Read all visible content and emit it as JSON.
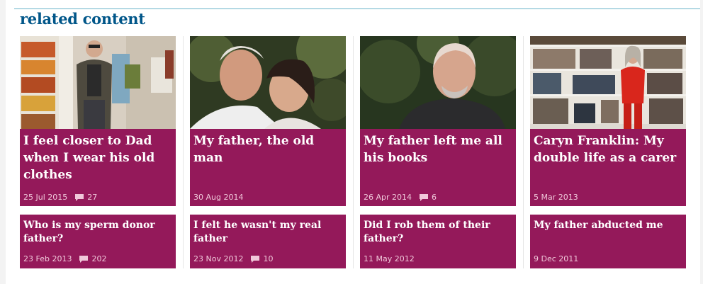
{
  "heading": "related content",
  "colors": {
    "accent": "#005689",
    "card_bg": "#94195a",
    "meta_text": "#f0c8da",
    "rule": "#69b4c9"
  },
  "feature_cards": [
    {
      "title": "I feel closer to Dad when I wear his old clothes",
      "date": "25 Jul 2015",
      "comments": "27",
      "image": "man-in-hallway-photo"
    },
    {
      "title": "My father, the old man",
      "date": "30 Aug 2014",
      "comments": null,
      "image": "father-and-daughter-photo"
    },
    {
      "title": "My father left me all his books",
      "date": "26 Apr 2014",
      "comments": "6",
      "image": "bald-man-portrait-photo"
    },
    {
      "title": "Caryn Franklin: My double life as a carer",
      "date": "5 Mar 2013",
      "comments": null,
      "image": "woman-by-bookshelf-photo"
    }
  ],
  "small_cards": [
    {
      "title": "Who is my sperm donor father?",
      "date": "23 Feb 2013",
      "comments": "202"
    },
    {
      "title": "I felt he wasn't my real father",
      "date": "23 Nov 2012",
      "comments": "10"
    },
    {
      "title": "Did I rob them of their father?",
      "date": "11 May 2012",
      "comments": null
    },
    {
      "title": "My father abducted me",
      "date": "9 Dec 2011",
      "comments": null
    }
  ]
}
